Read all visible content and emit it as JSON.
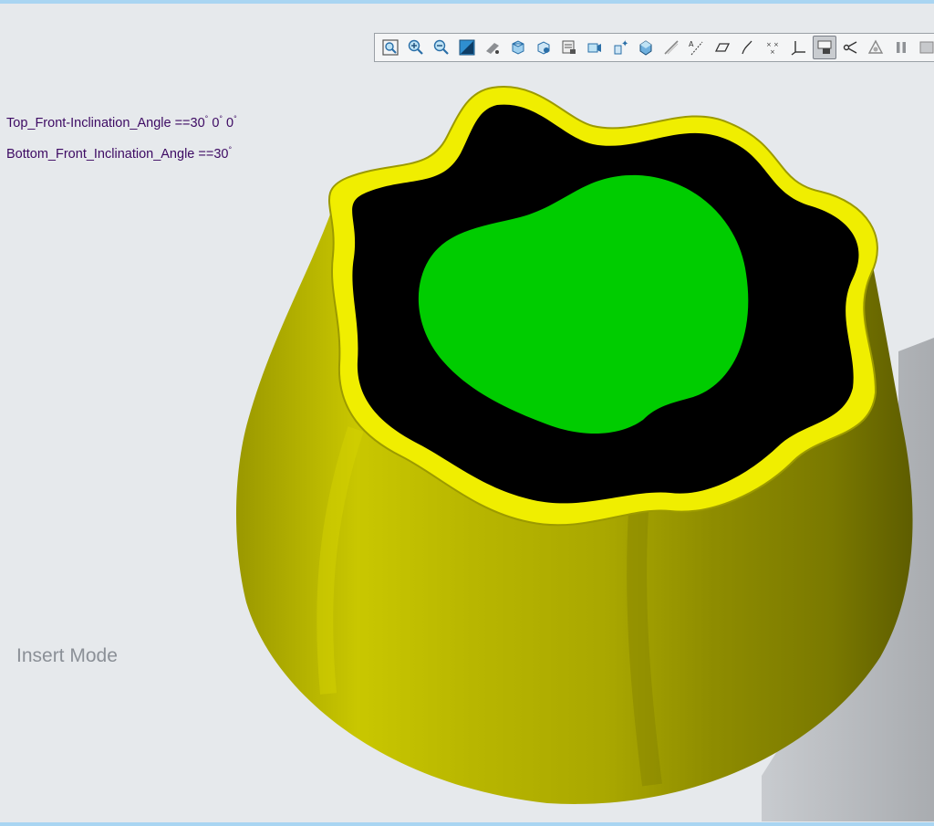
{
  "viewport": {
    "background": "#e6e9ec",
    "mode_label": "Insert Mode"
  },
  "parameters": {
    "top_front_inclination": {
      "label": "Top_Front-Inclination_Angle ==",
      "value_1": "30",
      "value_2": "0",
      "value_3": "0",
      "degree_mark": "°"
    },
    "bottom_front_inclination": {
      "label": "Bottom_Front_Inclination_Angle ==",
      "value_1": "30",
      "degree_mark": "°"
    }
  },
  "toolbar": {
    "icons": [
      "refit-icon",
      "zoom-in-icon",
      "zoom-out-icon",
      "repaint-icon",
      "spin-center-icon",
      "saved-orientations-icon",
      "named-views-icon",
      "view-manager-icon",
      "perspective-icon",
      "annotation-display-icon",
      "section-view-icon",
      "datum-display-icon",
      "datum-axes-icon",
      "datum-planes-icon",
      "datum-curves-icon",
      "datum-points-icon",
      "coordinate-systems-icon",
      "display-style-icon",
      "spin-center-toggle-icon",
      "appearance-icon",
      "pause-icon",
      "more-icon"
    ],
    "active_icon": "display-style-icon"
  },
  "model": {
    "body_color": "#c6c400",
    "rim_color": "#f2f000",
    "cavity_color": "#000000",
    "insert_color": "#00cc00"
  }
}
